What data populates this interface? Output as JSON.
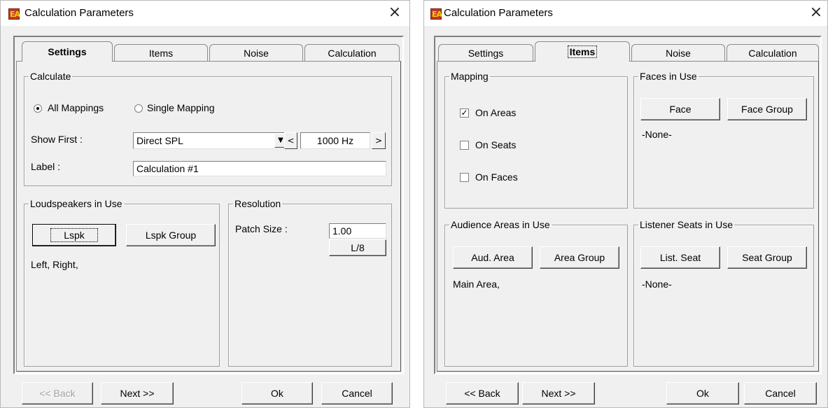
{
  "left": {
    "title": "Calculation Parameters",
    "close_glyph": "×",
    "tabs": [
      "Settings",
      "Items",
      "Noise",
      "Calculation"
    ],
    "calculate": {
      "legend": "Calculate",
      "all_mappings": "All Mappings",
      "single_mapping": "Single Mapping",
      "selected": "All Mappings",
      "show_first_label": "Show First :",
      "show_first_value": "Direct SPL",
      "freq_value": "1000 Hz",
      "prev_glyph": "<",
      "next_glyph": ">",
      "dropdown_glyph": "▼",
      "label_label": "Label :",
      "label_value": "Calculation #1"
    },
    "loudspeakers": {
      "legend": "Loudspeakers in Use",
      "lspk_button": "Lspk",
      "group_button": "Lspk Group",
      "list_text": "Left, Right,"
    },
    "resolution": {
      "legend": "Resolution",
      "patch_label": "Patch Size :",
      "patch_value": "1.00",
      "l8_button": "L/8"
    },
    "footer": {
      "back": "<< Back",
      "next": "Next >>",
      "ok": "Ok",
      "cancel": "Cancel"
    }
  },
  "right": {
    "title": "Calculation Parameters",
    "close_glyph": "×",
    "tabs": [
      "Settings",
      "Items",
      "Noise",
      "Calculation"
    ],
    "mapping": {
      "legend": "Mapping",
      "on_areas": "On Areas",
      "on_seats": "On Seats",
      "on_faces": "On Faces",
      "checked_glyph": "✓",
      "checked": {
        "on_areas": true,
        "on_seats": false,
        "on_faces": false
      }
    },
    "faces": {
      "legend": "Faces in Use",
      "face_button": "Face",
      "group_button": "Face Group",
      "list_text": "-None-"
    },
    "audience": {
      "legend": "Audience Areas in Use",
      "aud_button": "Aud. Area",
      "group_button": "Area Group",
      "list_text": "Main Area,"
    },
    "listeners": {
      "legend": "Listener Seats in Use",
      "seat_button": "List. Seat",
      "group_button": "Seat Group",
      "list_text": "-None-"
    },
    "footer": {
      "back": "<< Back",
      "next": "Next >>",
      "ok": "Ok",
      "cancel": "Cancel"
    }
  },
  "colors": {
    "dialog_bg": "#f0f0f0",
    "titlebar_bg": "#ffffff",
    "app_icon": "#c0392b"
  },
  "icons": {
    "app": "app-logo-icon",
    "close": "close-icon",
    "dropdown": "chevron-down-icon",
    "prev": "chevron-left-icon",
    "next": "chevron-right-icon",
    "check": "checkmark-icon"
  }
}
